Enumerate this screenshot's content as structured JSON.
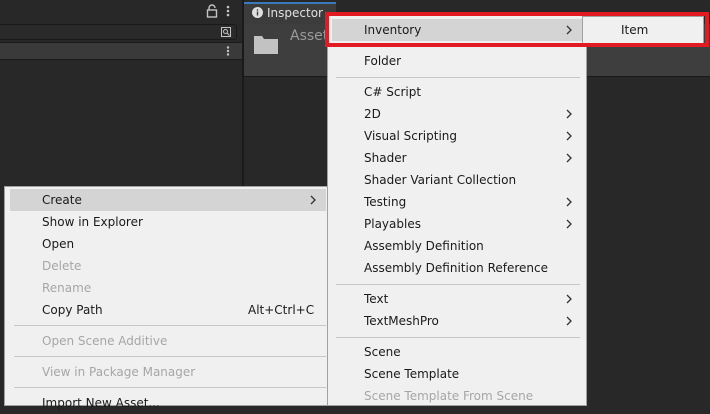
{
  "inspector": {
    "tab_label": "Inspector",
    "asset_name": "Asset"
  },
  "context_menu": {
    "items": [
      {
        "label": "Create",
        "submenu": true,
        "highlighted": true
      },
      {
        "label": "Show in Explorer"
      },
      {
        "label": "Open"
      },
      {
        "label": "Delete",
        "disabled": true
      },
      {
        "label": "Rename",
        "disabled": true
      },
      {
        "label": "Copy Path",
        "shortcut": "Alt+Ctrl+C"
      },
      {
        "label": "Open Scene Additive",
        "disabled": true
      },
      {
        "label": "View in Package Manager",
        "disabled": true
      },
      {
        "label": "Import New Asset..."
      }
    ]
  },
  "create_menu": {
    "items": [
      {
        "label": "Inventory",
        "submenu": true,
        "highlighted": true
      },
      {
        "label": "Folder"
      },
      {
        "label": "C# Script"
      },
      {
        "label": "2D",
        "submenu": true
      },
      {
        "label": "Visual Scripting",
        "submenu": true
      },
      {
        "label": "Shader",
        "submenu": true
      },
      {
        "label": "Shader Variant Collection"
      },
      {
        "label": "Testing",
        "submenu": true
      },
      {
        "label": "Playables",
        "submenu": true
      },
      {
        "label": "Assembly Definition"
      },
      {
        "label": "Assembly Definition Reference"
      },
      {
        "label": "Text",
        "submenu": true
      },
      {
        "label": "TextMeshPro",
        "submenu": true
      },
      {
        "label": "Scene"
      },
      {
        "label": "Scene Template"
      },
      {
        "label": "Scene Template From Scene",
        "disabled": true
      }
    ]
  },
  "inventory_menu": {
    "items": [
      {
        "label": "Item"
      }
    ]
  },
  "colors": {
    "highlight_box": "#e21b23",
    "menu_background": "#f0f0f0",
    "menu_hover": "#d4d4d4",
    "editor_background": "#282828"
  }
}
